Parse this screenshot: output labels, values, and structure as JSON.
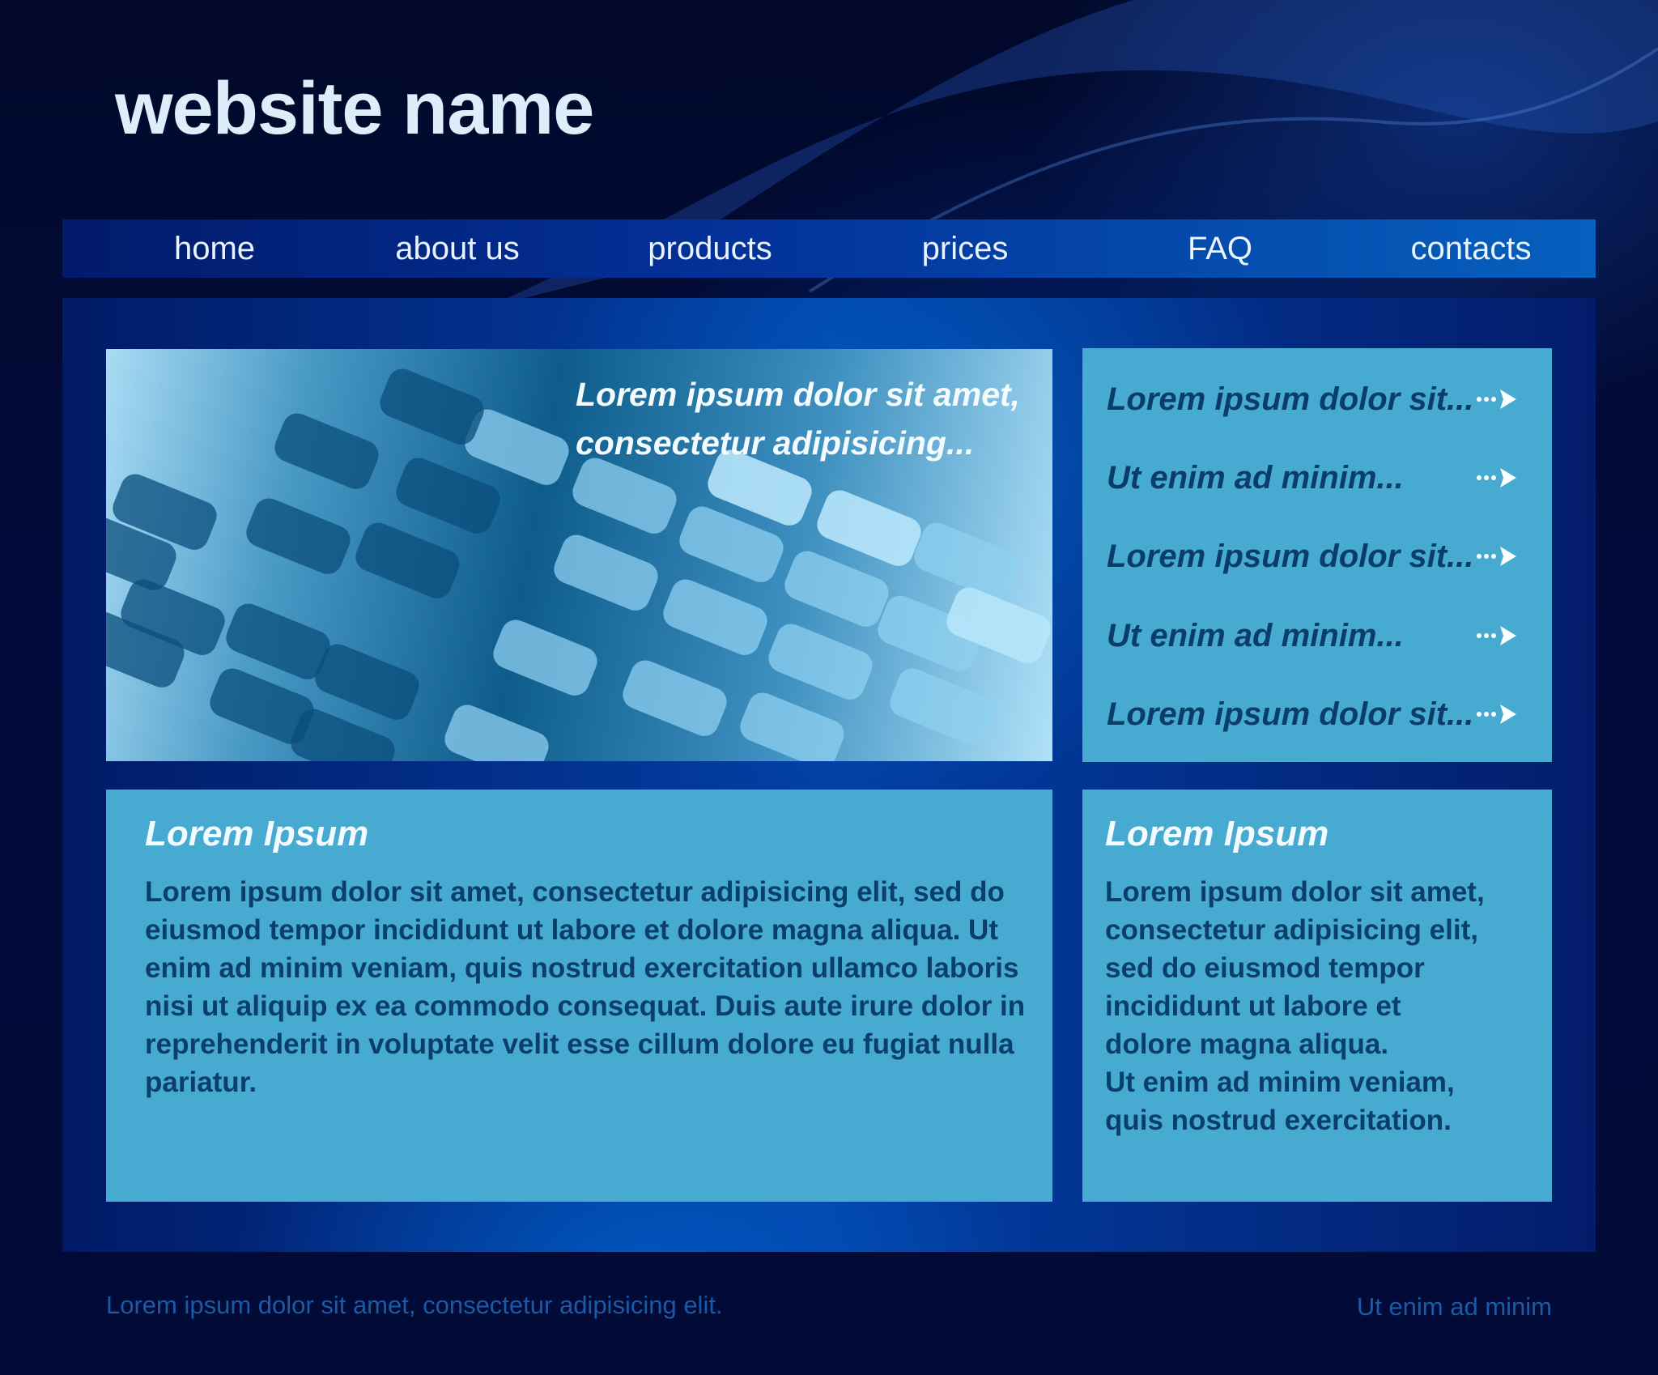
{
  "header": {
    "site_title": "website name"
  },
  "nav": {
    "items": [
      {
        "label": "home"
      },
      {
        "label": "about us"
      },
      {
        "label": "products"
      },
      {
        "label": "prices"
      },
      {
        "label": "FAQ"
      },
      {
        "label": "contacts"
      }
    ]
  },
  "hero": {
    "caption_line1": "Lorem ipsum dolor sit amet,",
    "caption_line2": "consectetur adipisicing..."
  },
  "links": {
    "items": [
      {
        "label": "Lorem ipsum dolor sit...",
        "icon": "arrow-right-icon"
      },
      {
        "label": "Ut enim ad minim...",
        "icon": "arrow-right-icon"
      },
      {
        "label": "Lorem ipsum dolor sit...",
        "icon": "arrow-right-icon"
      },
      {
        "label": "Ut enim ad minim...",
        "icon": "arrow-right-icon"
      },
      {
        "label": "Lorem ipsum dolor sit...",
        "icon": "arrow-right-icon"
      }
    ]
  },
  "main_panel": {
    "heading": "Lorem Ipsum",
    "body": "Lorem ipsum dolor sit amet, consectetur adipisicing elit, sed do eiusmod tempor incididunt ut labore et dolore magna aliqua. Ut enim ad minim veniam, quis nostrud exercitation ullamco laboris nisi ut aliquip ex ea commodo consequat. Duis aute irure dolor in reprehenderit in voluptate velit esse cillum dolore eu fugiat nulla pariatur."
  },
  "side_panel": {
    "heading": "Lorem Ipsum",
    "body_line1": "Lorem ipsum dolor sit amet,",
    "body_line2": "consectetur adipisicing elit,",
    "body_line3": "sed do eiusmod tempor",
    "body_line4": "incididunt ut labore et",
    "body_line5": "dolore magna aliqua.",
    "body_line6": "Ut enim ad minim veniam,",
    "body_line7": "quis nostrud exercitation."
  },
  "footer": {
    "left_text": "Lorem ipsum dolor sit amet, consectetur adipisicing elit.",
    "right_text": "Ut enim ad minim"
  },
  "colors": {
    "background": "#020c3c",
    "nav_bar": "#0660be",
    "content_panel": "#0240a6",
    "light_panel": "#46aad1",
    "title_text": "#dceefa",
    "dark_text": "#0b3f6b",
    "footer_text": "#1a5aa6"
  }
}
